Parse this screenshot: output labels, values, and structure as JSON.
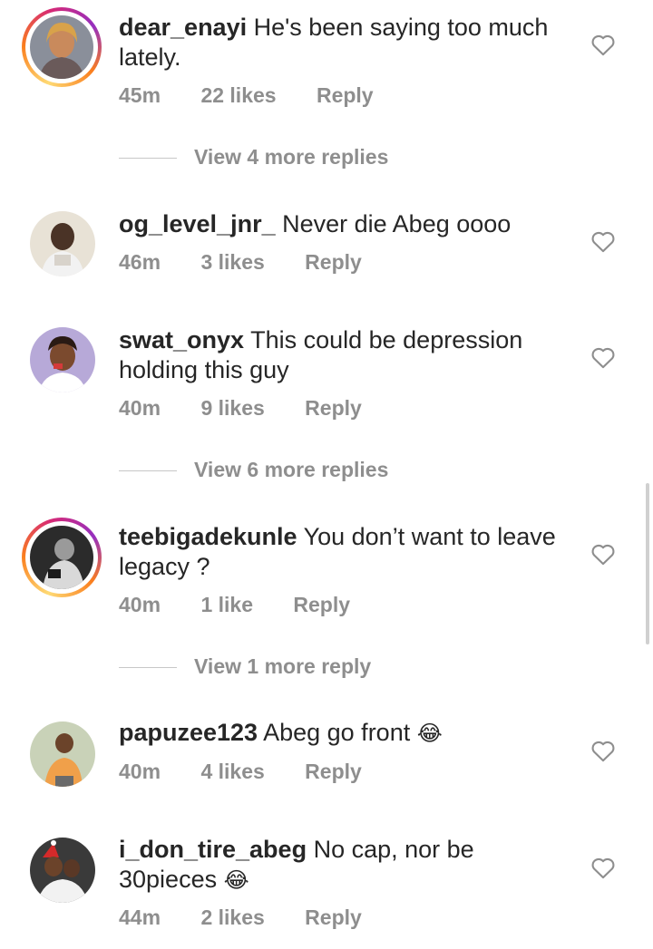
{
  "comments": [
    {
      "username": "dear_enayi",
      "text": "He's been saying too much lately.",
      "time": "45m",
      "likes": "22 likes",
      "reply": "Reply",
      "story_ring": true,
      "view_more": "View 4 more replies"
    },
    {
      "username": "og_level_jnr_",
      "text": "Never die Abeg oooo",
      "time": "46m",
      "likes": "3 likes",
      "reply": "Reply",
      "story_ring": false
    },
    {
      "username": "swat_onyx",
      "text": "This could be depression holding this guy",
      "time": "40m",
      "likes": "9 likes",
      "reply": "Reply",
      "story_ring": false,
      "view_more": "View 6 more replies"
    },
    {
      "username": "teebigadekunle",
      "text": "You don’t want to leave legacy ?",
      "time": "40m",
      "likes": "1 like",
      "reply": "Reply",
      "story_ring": true,
      "view_more": "View 1 more reply"
    },
    {
      "username": "papuzee123",
      "text": "Abeg go front",
      "emoji": "😂",
      "time": "40m",
      "likes": "4 likes",
      "reply": "Reply",
      "story_ring": false
    },
    {
      "username": "i_don_tire_abeg",
      "text": "No cap, nor be 30pieces",
      "emoji": "😂",
      "time": "44m",
      "likes": "2 likes",
      "reply": "Reply",
      "story_ring": false
    }
  ],
  "icons": {
    "like": "heart-outline-icon"
  },
  "colors": {
    "text": "#262626",
    "secondary": "#8e8e8e",
    "divider": "#c7c7c7"
  }
}
